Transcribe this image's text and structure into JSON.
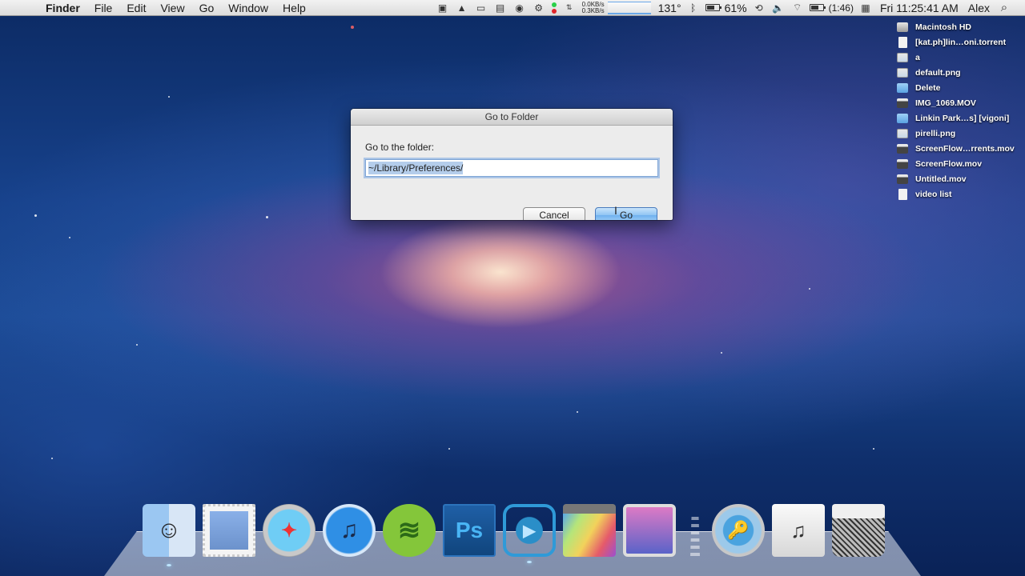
{
  "menubar": {
    "apple_menu": "",
    "app_name": "Finder",
    "menus": [
      "File",
      "Edit",
      "View",
      "Go",
      "Window",
      "Help"
    ],
    "status": {
      "net_down": "0.0KB/s",
      "net_up": "0.3KB/s",
      "temperature": "131°",
      "battery_percent": "61%",
      "battery_time": "(1:46)",
      "clock": "Fri 11:25:41 AM",
      "user": "Alex"
    },
    "status_icons": [
      "screen-record-icon",
      "google-drive-icon",
      "toggle-icon",
      "display-icon",
      "controller-icon",
      "gear-icon",
      "status-lights-icon",
      "updown-arrows-icon",
      "network-speed-icon",
      "cpu-temp-icon",
      "bluetooth-icon",
      "battery-icon",
      "time-machine-icon",
      "volume-icon",
      "wifi-icon",
      "battery-time-icon",
      "input-menu-icon",
      "spotlight-search-icon"
    ]
  },
  "dialog": {
    "title": "Go to Folder",
    "label": "Go to the folder:",
    "input_value": "~/Library/Preferences/",
    "cancel_label": "Cancel",
    "go_label": "Go"
  },
  "desktop_items": [
    {
      "name": "Macintosh HD",
      "icon": "hard-drive"
    },
    {
      "name": "[kat.ph]lin…oni.torrent",
      "icon": "document"
    },
    {
      "name": "a",
      "icon": "image"
    },
    {
      "name": "default.png",
      "icon": "image"
    },
    {
      "name": "Delete",
      "icon": "folder"
    },
    {
      "name": "IMG_1069.MOV",
      "icon": "movie"
    },
    {
      "name": "Linkin Park…s] [vigoni]",
      "icon": "folder"
    },
    {
      "name": "pirelli.png",
      "icon": "image"
    },
    {
      "name": "ScreenFlow…rrents.mov",
      "icon": "movie"
    },
    {
      "name": "ScreenFlow.mov",
      "icon": "movie"
    },
    {
      "name": "Untitled.mov",
      "icon": "movie"
    },
    {
      "name": "video list",
      "icon": "document"
    }
  ],
  "dock": {
    "apps": [
      {
        "name": "Finder",
        "glyph": "☺"
      },
      {
        "name": "Mail",
        "glyph": ""
      },
      {
        "name": "Safari",
        "glyph": "✦"
      },
      {
        "name": "iTunes",
        "glyph": "♫"
      },
      {
        "name": "Spotify",
        "glyph": "≋"
      },
      {
        "name": "Photoshop",
        "glyph": "Ps"
      },
      {
        "name": "ScreenFlow",
        "glyph": "▶"
      },
      {
        "name": "Final Cut Pro",
        "glyph": ""
      },
      {
        "name": "iMovie",
        "glyph": ""
      }
    ],
    "others": [
      {
        "name": "1Password",
        "glyph": "🔑"
      },
      {
        "name": "Applications Stack",
        "glyph": "♫"
      },
      {
        "name": "Trash",
        "glyph": ""
      }
    ]
  }
}
